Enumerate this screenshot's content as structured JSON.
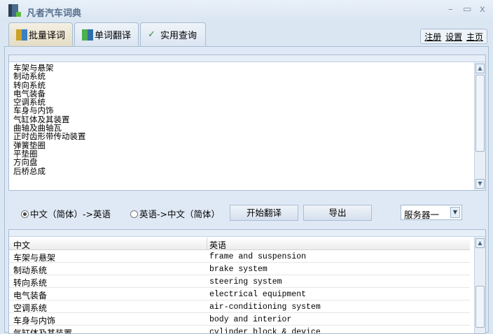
{
  "window": {
    "title": "凡者汽车词典",
    "minimize": "–",
    "maximize": "▭",
    "close": "x"
  },
  "tabs": [
    {
      "label": "批量译词"
    },
    {
      "label": "单词翻译"
    },
    {
      "label": "实用查询"
    }
  ],
  "links": {
    "register": "注册",
    "settings": "设置",
    "home": "主页"
  },
  "source_lines": [
    "车架与悬架",
    "制动系统",
    "转向系统",
    "电气装备",
    "空调系统",
    "车身与内饰",
    "气缸体及其装置",
    "曲轴及曲轴瓦",
    "正时齿形带传动装置",
    "弹簧垫圈",
    "平垫圈",
    "方向盘",
    "后桥总成"
  ],
  "controls": {
    "radio_cn_en": "中文（简体）->英语",
    "radio_en_cn": "英语->中文（简体）",
    "selected_direction": "cn_en",
    "start_button": "开始翻译",
    "export_button": "导出",
    "server_select": "服务器一"
  },
  "table": {
    "headers": [
      "中文",
      "英语"
    ],
    "rows": [
      [
        "车架与悬架",
        "frame and suspension"
      ],
      [
        "制动系统",
        "brake system"
      ],
      [
        "转向系统",
        "steering system"
      ],
      [
        "电气装备",
        "electrical equipment"
      ],
      [
        "空调系统",
        "air-conditioning system"
      ],
      [
        "车身与内饰",
        "body and interior"
      ],
      [
        "气缸体及其装置",
        "cylinder block & device"
      ]
    ]
  }
}
